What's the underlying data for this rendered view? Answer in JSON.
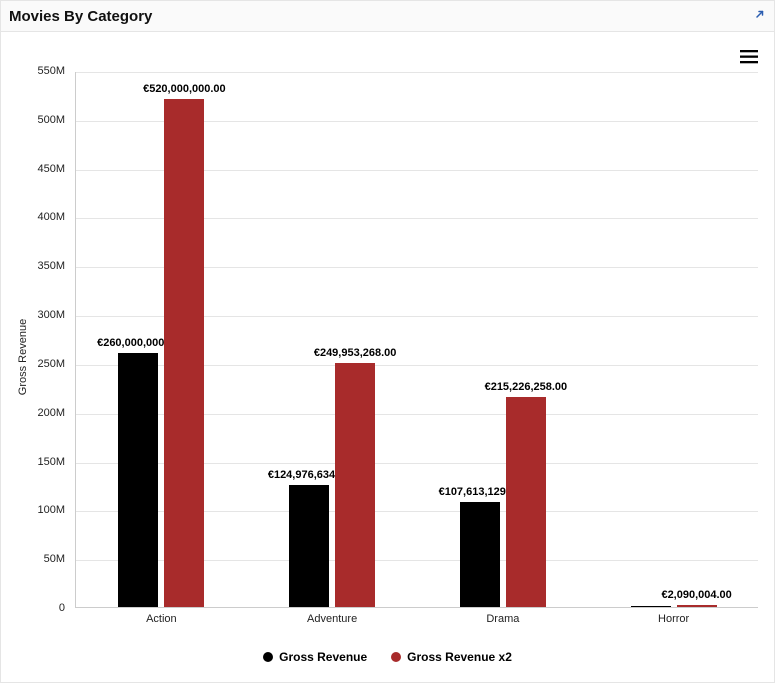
{
  "header": {
    "title": "Movies By Category"
  },
  "chart_data": {
    "type": "bar",
    "title": "Movies By Category",
    "ylabel": "Gross Revenue",
    "xlabel": "",
    "categories": [
      "Action",
      "Adventure",
      "Drama",
      "Horror"
    ],
    "series": [
      {
        "name": "Gross Revenue",
        "color": "#000000",
        "values": [
          260000000,
          124976634,
          107613129,
          1045002
        ]
      },
      {
        "name": "Gross Revenue x2",
        "color": "#a82b2b",
        "values": [
          520000000,
          249953268,
          215226258,
          2090004
        ]
      }
    ],
    "value_labels": [
      [
        "€260,000,000.00",
        "€124,976,634.00",
        "€107,613,129.00",
        ""
      ],
      [
        "€520,000,000.00",
        "€249,953,268.00",
        "€215,226,258.00",
        "€2,090,004.00"
      ]
    ],
    "ylim": [
      0,
      550000000
    ],
    "yticks": [
      0,
      50,
      100,
      150,
      200,
      250,
      300,
      350,
      400,
      450,
      500,
      550
    ],
    "ytick_labels": [
      "0",
      "50M",
      "100M",
      "150M",
      "200M",
      "250M",
      "300M",
      "350M",
      "400M",
      "450M",
      "500M",
      "550M"
    ],
    "legend_position": "bottom"
  }
}
